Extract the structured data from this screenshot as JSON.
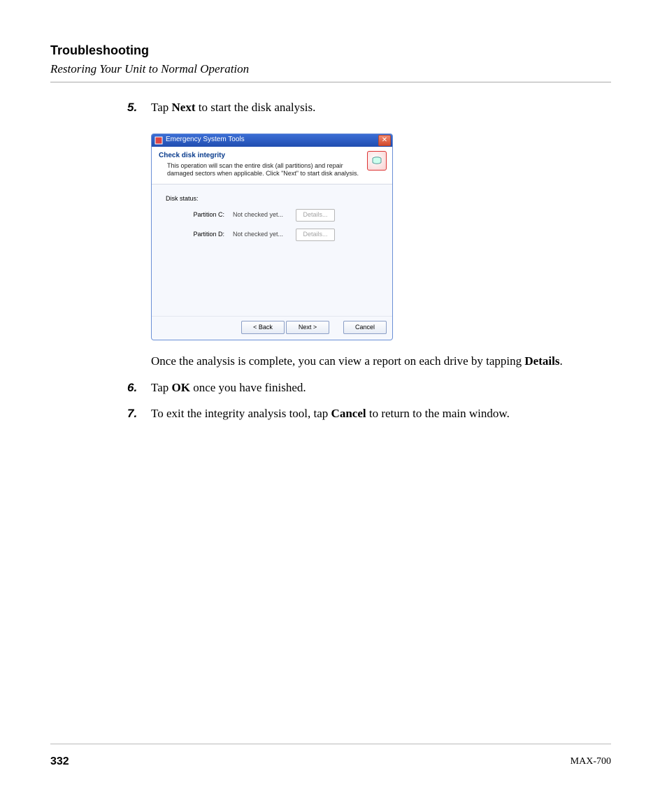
{
  "header": {
    "title": "Troubleshooting",
    "subtitle": "Restoring Your Unit to Normal Operation"
  },
  "steps": {
    "s5": {
      "num": "5.",
      "text_before": "Tap ",
      "bold": "Next",
      "text_after": " to start the disk analysis."
    },
    "followup": {
      "text_before": "Once the analysis is complete, you can view a report on each drive by tapping ",
      "bold": "Details",
      "text_after": "."
    },
    "s6": {
      "num": "6.",
      "text_before": "Tap ",
      "bold": "OK",
      "text_after": " once you have finished."
    },
    "s7": {
      "num": "7.",
      "text_before": "To exit the integrity analysis tool, tap ",
      "bold": "Cancel",
      "text_after": " to return to the main window."
    }
  },
  "dialog": {
    "title": "Emergency System Tools",
    "section_title": "Check disk integrity",
    "section_desc": "This operation will scan the entire disk (all partitions) and repair damaged sectors when applicable. Click \"Next\" to start disk analysis.",
    "disk_status_label": "Disk status:",
    "rows": [
      {
        "name": "Partition C:",
        "status": "Not checked yet...",
        "details": "Details..."
      },
      {
        "name": "Partition D:",
        "status": "Not checked yet...",
        "details": "Details..."
      }
    ],
    "back_btn": "< Back",
    "next_btn": "Next >",
    "cancel_btn": "Cancel",
    "close_glyph": "✕"
  },
  "footer": {
    "page_number": "332",
    "model": "MAX-700"
  }
}
